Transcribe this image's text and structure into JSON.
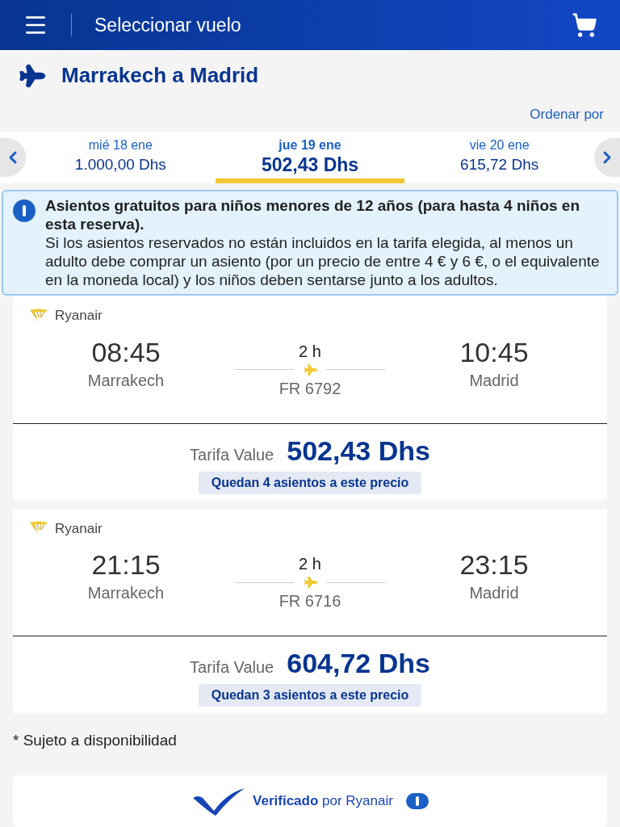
{
  "header": {
    "title": "Seleccionar vuelo"
  },
  "route": {
    "title": "Marrakech a Madrid",
    "sort_link": "Ordenar por"
  },
  "dates": [
    {
      "day": "mié 18 ene",
      "price": "1.000,00 Dhs",
      "selected": false
    },
    {
      "day": "jue 19 ene",
      "price": "502,43 Dhs",
      "selected": true
    },
    {
      "day": "vie 20 ene",
      "price": "615,72 Dhs",
      "selected": false
    }
  ],
  "notice": {
    "title": "Asientos gratuitos para niños menores de 12 años (para hasta 4 niños en esta reserva).",
    "body": "Si los asientos reservados no están incluidos en la tarifa elegida, al menos un adulto debe comprar un asiento (por un precio de entre 4 € y 6 €, o el equivalente en la moneda local) y los niños deben sentarse junto a los adultos."
  },
  "flights": [
    {
      "airline": "Ryanair",
      "depart_time": "08:45",
      "depart_city": "Marrakech",
      "duration": "2 h",
      "flight_number": "FR 6792",
      "arrive_time": "10:45",
      "arrive_city": "Madrid",
      "fare_label": "Tarifa Value",
      "price": "502,43 Dhs",
      "seats_note": "Quedan 4 asientos a este precio"
    },
    {
      "airline": "Ryanair",
      "depart_time": "21:15",
      "depart_city": "Marrakech",
      "duration": "2 h",
      "flight_number": "FR 6716",
      "arrive_time": "23:15",
      "arrive_city": "Madrid",
      "fare_label": "Tarifa Value",
      "price": "604,72 Dhs",
      "seats_note": "Quedan 3 asientos a este precio"
    }
  ],
  "footnote": "* Sujeto a disponibilidad",
  "verified": "**Verificado** por Ryanair"
}
